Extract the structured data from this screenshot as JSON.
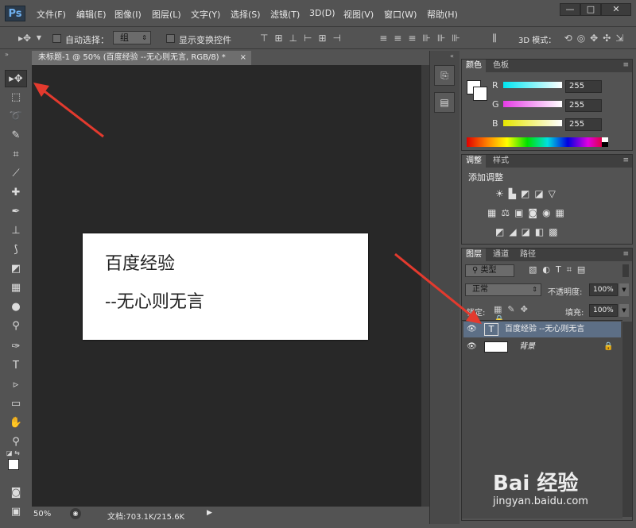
{
  "app": {
    "logo": "Ps"
  },
  "menu": [
    "文件(F)",
    "编辑(E)",
    "图像(I)",
    "图层(L)",
    "文字(Y)",
    "选择(S)",
    "滤镜(T)",
    "3D(D)",
    "视图(V)",
    "窗口(W)",
    "帮助(H)"
  ],
  "window_buttons": [
    "—",
    "□",
    "✕"
  ],
  "options": {
    "auto_select_label": "自动选择：",
    "auto_select_value": "组",
    "show_transform_label": "显示变换控件",
    "mode_3d_label": "3D 模式："
  },
  "document": {
    "tab_title": "未标题-1 @ 50% (百度经验 --无心则无言, RGB/8) *",
    "close_glyph": "×",
    "canvas_line1": "百度经验",
    "canvas_line2": "--无心则无言"
  },
  "status": {
    "zoom": "50%",
    "doc_info": "文档:703.1K/215.6K"
  },
  "color_panel": {
    "tabs": [
      "颜色",
      "色板"
    ],
    "channels": [
      {
        "label": "R",
        "value": "255",
        "color": "#00c8d2"
      },
      {
        "label": "G",
        "value": "255",
        "color": "#d23cd2"
      },
      {
        "label": "B",
        "value": "255",
        "color": "#d2d200"
      }
    ]
  },
  "adjust_panel": {
    "tabs": [
      "调整",
      "样式"
    ],
    "title": "添加调整"
  },
  "layers_panel": {
    "tabs": [
      "图层",
      "通道",
      "路径"
    ],
    "filter_label": "类型",
    "blend_mode": "正常",
    "opacity_label": "不透明度:",
    "opacity_value": "100%",
    "lock_label": "锁定:",
    "fill_label": "填充:",
    "fill_value": "100%",
    "layers": [
      {
        "name": "百度经验 --无心则无言",
        "kind": "text",
        "thumb": "T"
      },
      {
        "name": "背景",
        "kind": "background"
      }
    ]
  },
  "watermark": {
    "brand": "Bai 经验",
    "url": "jingyan.baidu.com"
  },
  "colors": {
    "accent_arrow": "#e33a2e",
    "selected_layer": "#5d6f86"
  }
}
